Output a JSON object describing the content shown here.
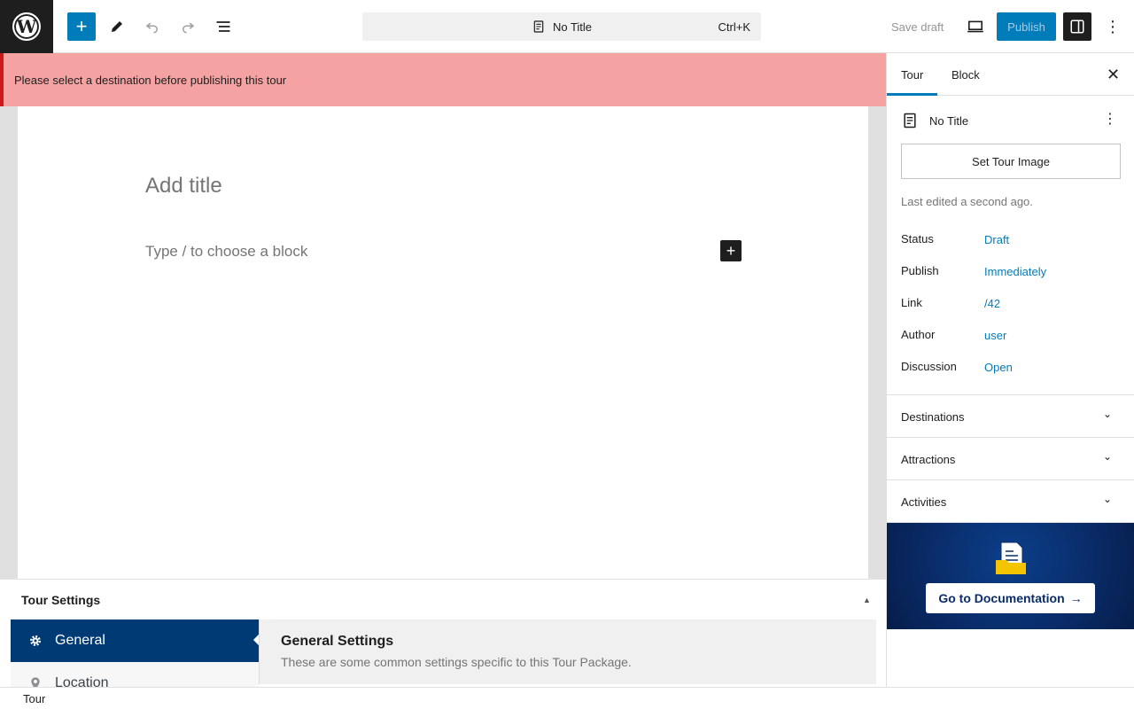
{
  "topbar": {
    "logo_letter": "W",
    "add_icon": "plus-icon",
    "command_title": "No Title",
    "command_shortcut": "Ctrl+K",
    "save_draft": "Save draft",
    "publish": "Publish",
    "more_icon": "vertical-ellipsis-icon"
  },
  "notice": {
    "text": "Please select a destination before publishing this tour"
  },
  "editor": {
    "title_placeholder": "Add title",
    "block_placeholder": "Type / to choose a block"
  },
  "tour_settings": {
    "header": "Tour Settings",
    "nav": [
      {
        "label": "General",
        "icon": "gear-icon"
      },
      {
        "label": "Location",
        "icon": "location-pin-icon"
      }
    ],
    "content_title": "General Settings",
    "content_desc": "These are some common settings specific to this Tour Package."
  },
  "footer": {
    "breadcrumb": "Tour"
  },
  "sidebar": {
    "tabs": [
      "Tour",
      "Block"
    ],
    "doc_title": "No Title",
    "set_image": "Set Tour Image",
    "last_edited": "Last edited a second ago.",
    "meta": [
      {
        "key": "Status",
        "value": "Draft"
      },
      {
        "key": "Publish",
        "value": "Immediately"
      },
      {
        "key": "Link",
        "value": "/42"
      },
      {
        "key": "Author",
        "value": "user"
      },
      {
        "key": "Discussion",
        "value": "Open"
      }
    ],
    "panels": [
      "Destinations",
      "Attractions",
      "Activities"
    ],
    "doc_button": "Go to Documentation"
  },
  "colors": {
    "accent": "#007cba",
    "notice_bg": "#f4a2a2",
    "nav_active": "#003a75"
  }
}
